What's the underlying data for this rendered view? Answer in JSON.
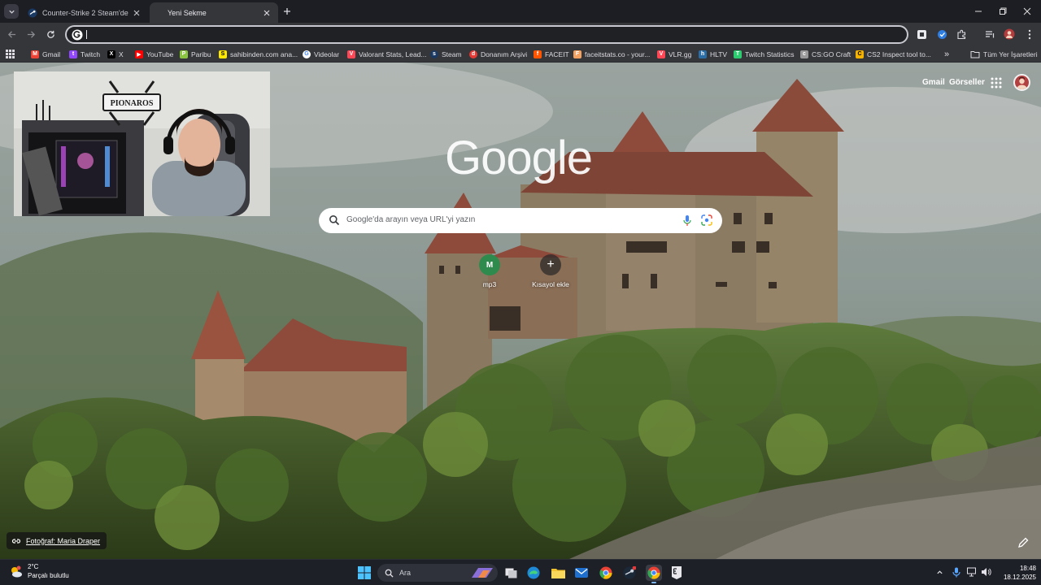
{
  "tabs": [
    {
      "title": "Counter-Strike 2 Steam'de",
      "active": false,
      "favicon": "steam-icon"
    },
    {
      "title": "Yeni Sekme",
      "active": true,
      "favicon": ""
    }
  ],
  "omnibox": {
    "value": "",
    "placeholder": ""
  },
  "bookmarks": [
    {
      "label": "Gmail",
      "icon": "gmail-icon",
      "color": "#ea4335"
    },
    {
      "label": "Twitch",
      "icon": "twitch-icon",
      "color": "#9146ff"
    },
    {
      "label": "X",
      "icon": "x-icon",
      "color": "#000000"
    },
    {
      "label": "YouTube",
      "icon": "youtube-icon",
      "color": "#ff0000"
    },
    {
      "label": "Paribu",
      "icon": "paribu-icon",
      "color": "#8ac53f"
    },
    {
      "label": "sahibinden.com ana...",
      "icon": "sahibinden-icon",
      "color": "#ffe800"
    },
    {
      "label": "Videolar",
      "icon": "videolar-icon",
      "color": "#ffffff"
    },
    {
      "label": "Valorant Stats, Lead...",
      "icon": "valorant-icon",
      "color": "#ff4655"
    },
    {
      "label": "Steam",
      "icon": "steam-icon",
      "color": "#1b2838"
    },
    {
      "label": "Donanım Arşivi",
      "icon": "donanim-icon",
      "color": "#e53935"
    },
    {
      "label": "FACEIT",
      "icon": "faceit-icon",
      "color": "#ff5500"
    },
    {
      "label": "faceitstats.co - your...",
      "icon": "faceitstats-icon",
      "color": "#f4a261"
    },
    {
      "label": "VLR.gg",
      "icon": "vlr-icon",
      "color": "#ff4655"
    },
    {
      "label": "HLTV",
      "icon": "hltv-icon",
      "color": "#2b6ea6"
    },
    {
      "label": "Twitch Statistics",
      "icon": "twitchstats-icon",
      "color": "#2ecc71"
    },
    {
      "label": "CS:GO Craft",
      "icon": "csgocraft-icon",
      "color": "#999999"
    },
    {
      "label": "CS2 Inspect tool to...",
      "icon": "cs2inspect-icon",
      "color": "#f5b301"
    }
  ],
  "bookmarks_overflow": "»",
  "all_bookmarks": "Tüm Yer İşaretleri",
  "ntp": {
    "gmail": "Gmail",
    "images": "Görseller",
    "logo": "Google",
    "search_placeholder": "Google'da arayın veya URL'yi yazın",
    "shortcuts": [
      {
        "letter": "M",
        "label": "mp3"
      },
      {
        "letter": "+",
        "label": "Kısayol ekle"
      }
    ],
    "photo_credit": "Fotoğraf: Maria Draper"
  },
  "webcam": {
    "banner_text": "PIONAROS"
  },
  "taskbar": {
    "weather_temp": "2°C",
    "weather_cond": "Parçalı bulutlu",
    "search_label": "Ara",
    "time": "18:48",
    "date": "18.12.2025"
  },
  "colors": {
    "accent": "#8ab4f8",
    "tab_bar": "#1d1d24",
    "toolbar": "#35363a"
  }
}
